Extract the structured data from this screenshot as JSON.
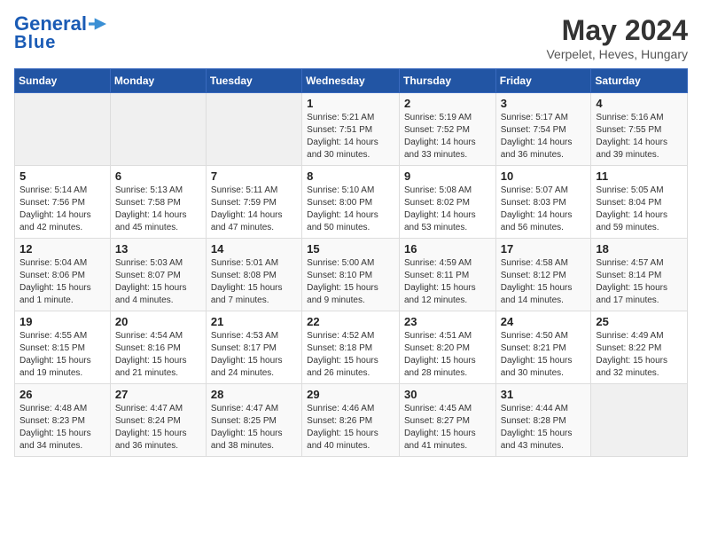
{
  "header": {
    "logo_line1": "General",
    "logo_line2": "Blue",
    "month": "May 2024",
    "location": "Verpelet, Heves, Hungary"
  },
  "days_of_week": [
    "Sunday",
    "Monday",
    "Tuesday",
    "Wednesday",
    "Thursday",
    "Friday",
    "Saturday"
  ],
  "weeks": [
    [
      {
        "num": "",
        "info": ""
      },
      {
        "num": "",
        "info": ""
      },
      {
        "num": "",
        "info": ""
      },
      {
        "num": "1",
        "info": "Sunrise: 5:21 AM\nSunset: 7:51 PM\nDaylight: 14 hours and 30 minutes."
      },
      {
        "num": "2",
        "info": "Sunrise: 5:19 AM\nSunset: 7:52 PM\nDaylight: 14 hours and 33 minutes."
      },
      {
        "num": "3",
        "info": "Sunrise: 5:17 AM\nSunset: 7:54 PM\nDaylight: 14 hours and 36 minutes."
      },
      {
        "num": "4",
        "info": "Sunrise: 5:16 AM\nSunset: 7:55 PM\nDaylight: 14 hours and 39 minutes."
      }
    ],
    [
      {
        "num": "5",
        "info": "Sunrise: 5:14 AM\nSunset: 7:56 PM\nDaylight: 14 hours and 42 minutes."
      },
      {
        "num": "6",
        "info": "Sunrise: 5:13 AM\nSunset: 7:58 PM\nDaylight: 14 hours and 45 minutes."
      },
      {
        "num": "7",
        "info": "Sunrise: 5:11 AM\nSunset: 7:59 PM\nDaylight: 14 hours and 47 minutes."
      },
      {
        "num": "8",
        "info": "Sunrise: 5:10 AM\nSunset: 8:00 PM\nDaylight: 14 hours and 50 minutes."
      },
      {
        "num": "9",
        "info": "Sunrise: 5:08 AM\nSunset: 8:02 PM\nDaylight: 14 hours and 53 minutes."
      },
      {
        "num": "10",
        "info": "Sunrise: 5:07 AM\nSunset: 8:03 PM\nDaylight: 14 hours and 56 minutes."
      },
      {
        "num": "11",
        "info": "Sunrise: 5:05 AM\nSunset: 8:04 PM\nDaylight: 14 hours and 59 minutes."
      }
    ],
    [
      {
        "num": "12",
        "info": "Sunrise: 5:04 AM\nSunset: 8:06 PM\nDaylight: 15 hours and 1 minute."
      },
      {
        "num": "13",
        "info": "Sunrise: 5:03 AM\nSunset: 8:07 PM\nDaylight: 15 hours and 4 minutes."
      },
      {
        "num": "14",
        "info": "Sunrise: 5:01 AM\nSunset: 8:08 PM\nDaylight: 15 hours and 7 minutes."
      },
      {
        "num": "15",
        "info": "Sunrise: 5:00 AM\nSunset: 8:10 PM\nDaylight: 15 hours and 9 minutes."
      },
      {
        "num": "16",
        "info": "Sunrise: 4:59 AM\nSunset: 8:11 PM\nDaylight: 15 hours and 12 minutes."
      },
      {
        "num": "17",
        "info": "Sunrise: 4:58 AM\nSunset: 8:12 PM\nDaylight: 15 hours and 14 minutes."
      },
      {
        "num": "18",
        "info": "Sunrise: 4:57 AM\nSunset: 8:14 PM\nDaylight: 15 hours and 17 minutes."
      }
    ],
    [
      {
        "num": "19",
        "info": "Sunrise: 4:55 AM\nSunset: 8:15 PM\nDaylight: 15 hours and 19 minutes."
      },
      {
        "num": "20",
        "info": "Sunrise: 4:54 AM\nSunset: 8:16 PM\nDaylight: 15 hours and 21 minutes."
      },
      {
        "num": "21",
        "info": "Sunrise: 4:53 AM\nSunset: 8:17 PM\nDaylight: 15 hours and 24 minutes."
      },
      {
        "num": "22",
        "info": "Sunrise: 4:52 AM\nSunset: 8:18 PM\nDaylight: 15 hours and 26 minutes."
      },
      {
        "num": "23",
        "info": "Sunrise: 4:51 AM\nSunset: 8:20 PM\nDaylight: 15 hours and 28 minutes."
      },
      {
        "num": "24",
        "info": "Sunrise: 4:50 AM\nSunset: 8:21 PM\nDaylight: 15 hours and 30 minutes."
      },
      {
        "num": "25",
        "info": "Sunrise: 4:49 AM\nSunset: 8:22 PM\nDaylight: 15 hours and 32 minutes."
      }
    ],
    [
      {
        "num": "26",
        "info": "Sunrise: 4:48 AM\nSunset: 8:23 PM\nDaylight: 15 hours and 34 minutes."
      },
      {
        "num": "27",
        "info": "Sunrise: 4:47 AM\nSunset: 8:24 PM\nDaylight: 15 hours and 36 minutes."
      },
      {
        "num": "28",
        "info": "Sunrise: 4:47 AM\nSunset: 8:25 PM\nDaylight: 15 hours and 38 minutes."
      },
      {
        "num": "29",
        "info": "Sunrise: 4:46 AM\nSunset: 8:26 PM\nDaylight: 15 hours and 40 minutes."
      },
      {
        "num": "30",
        "info": "Sunrise: 4:45 AM\nSunset: 8:27 PM\nDaylight: 15 hours and 41 minutes."
      },
      {
        "num": "31",
        "info": "Sunrise: 4:44 AM\nSunset: 8:28 PM\nDaylight: 15 hours and 43 minutes."
      },
      {
        "num": "",
        "info": ""
      }
    ]
  ]
}
